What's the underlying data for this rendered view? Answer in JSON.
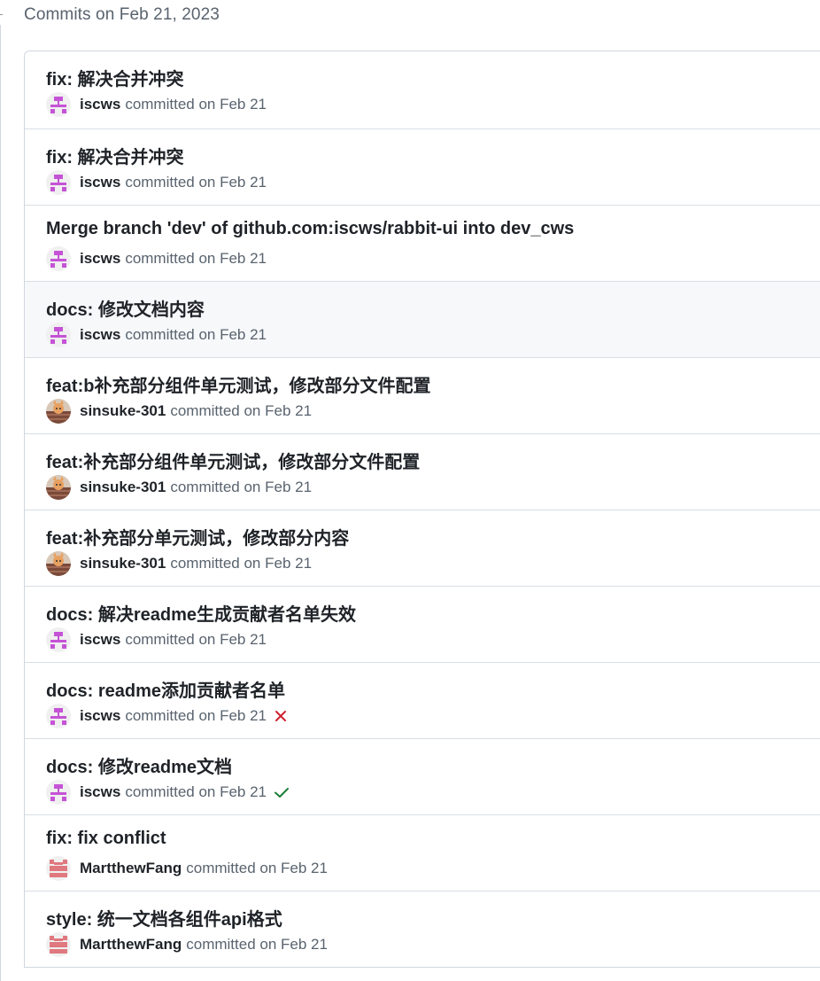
{
  "group": {
    "header": "Commits on Feb 21, 2023"
  },
  "commits": [
    {
      "title": "fix: 解决合并冲突",
      "author": "iscws",
      "meta": "committed on Feb 21",
      "avatar": "iscws",
      "status": ""
    },
    {
      "title": "fix: 解决合并冲突",
      "author": "iscws",
      "meta": "committed on Feb 21",
      "avatar": "iscws",
      "status": ""
    },
    {
      "title": "Merge branch 'dev' of github.com:iscws/rabbit-ui into dev_cws",
      "author": "iscws",
      "meta": "committed on Feb 21",
      "avatar": "iscws",
      "status": ""
    },
    {
      "title": "docs: 修改文档内容",
      "author": "iscws",
      "meta": "committed on Feb 21",
      "avatar": "iscws",
      "status": "",
      "highlighted": true
    },
    {
      "title": "feat:b补充部分组件单元测试，修改部分文件配置",
      "author": "sinsuke-301",
      "meta": "committed on Feb 21",
      "avatar": "sinsuke",
      "status": ""
    },
    {
      "title": "feat:补充部分组件单元测试，修改部分文件配置",
      "author": "sinsuke-301",
      "meta": "committed on Feb 21",
      "avatar": "sinsuke",
      "status": ""
    },
    {
      "title": "feat:补充部分单元测试，修改部分内容",
      "author": "sinsuke-301",
      "meta": "committed on Feb 21",
      "avatar": "sinsuke",
      "status": ""
    },
    {
      "title": "docs: 解决readme生成贡献者名单失效",
      "author": "iscws",
      "meta": "committed on Feb 21",
      "avatar": "iscws",
      "status": ""
    },
    {
      "title": "docs: readme添加贡献者名单",
      "author": "iscws",
      "meta": "committed on Feb 21",
      "avatar": "iscws",
      "status": "failure"
    },
    {
      "title": "docs: 修改readme文档",
      "author": "iscws",
      "meta": "committed on Feb 21",
      "avatar": "iscws",
      "status": "success"
    },
    {
      "title": "fix: fix conflict",
      "author": "MartthewFang",
      "meta": "committed on Feb 21",
      "avatar": "martthew",
      "status": ""
    },
    {
      "title": "style: 统一文档各组件api格式",
      "author": "MartthewFang",
      "meta": "committed on Feb 21",
      "avatar": "martthew",
      "status": ""
    }
  ],
  "icons": {
    "failure": "x-icon",
    "success": "check-icon"
  },
  "colors": {
    "failure": "#cf222e",
    "success": "#1a7f37",
    "iscws_avatar": "#c553d6",
    "martthew_avatar": "#e0787f"
  }
}
